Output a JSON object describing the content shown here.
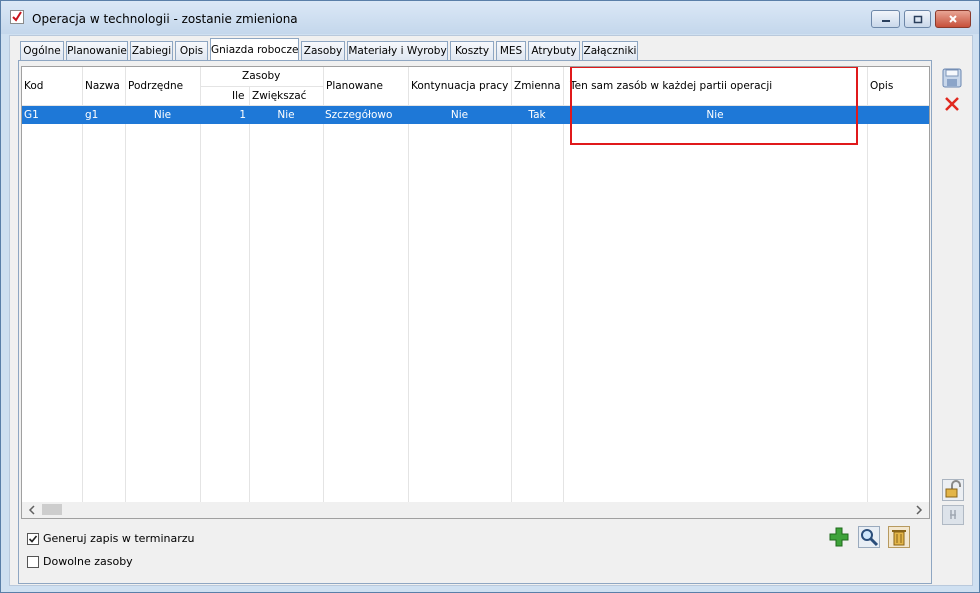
{
  "window": {
    "title": "Operacja w technologii - zostanie zmieniona"
  },
  "tabs": [
    {
      "label": "Ogólne",
      "active": false
    },
    {
      "label": "Planowanie",
      "active": false
    },
    {
      "label": "Zabiegi",
      "active": false
    },
    {
      "label": "Opis",
      "active": false
    },
    {
      "label": "Gniazda robocze",
      "active": true
    },
    {
      "label": "Zasoby",
      "active": false
    },
    {
      "label": "Materiały i Wyroby",
      "active": false
    },
    {
      "label": "Koszty",
      "active": false
    },
    {
      "label": "MES",
      "active": false
    },
    {
      "label": "Atrybuty",
      "active": false
    },
    {
      "label": "Załączniki",
      "active": false
    }
  ],
  "grid": {
    "headers": {
      "kod": "Kod",
      "nazwa": "Nazwa",
      "podrzedne": "Podrzędne",
      "zasoby_group": "Zasoby",
      "ile": "Ile",
      "zwiekszac": "Zwiększać",
      "planowane": "Planowane",
      "kontynuacja": "Kontynuacja pracy",
      "zmienna": "Zmienna",
      "ten_sam": "Ten sam zasób w każdej partii operacji",
      "opis": "Opis"
    },
    "rows": [
      {
        "kod": "G1",
        "nazwa": "g1",
        "podrzedne": "Nie",
        "ile": "1",
        "zwiekszac": "Nie",
        "planowane": "Szczegółowo",
        "kontynuacja": "Nie",
        "zmienna": "Tak",
        "ten_sam": "Nie",
        "opis": ""
      }
    ]
  },
  "options": {
    "generuj_label": "Generuj zapis w terminarzu",
    "generuj_checked": true,
    "dowolne_label": "Dowolne zasoby",
    "dowolne_checked": false
  },
  "colors": {
    "selection": "#1e78d7",
    "highlight_box": "#e0191b",
    "window_frame": "#cfe0f1"
  },
  "icons": {
    "save": "save-icon",
    "delete": "delete-icon",
    "lock": "lock-icon",
    "add": "add-icon",
    "search": "search-icon",
    "trash": "trash-icon"
  }
}
